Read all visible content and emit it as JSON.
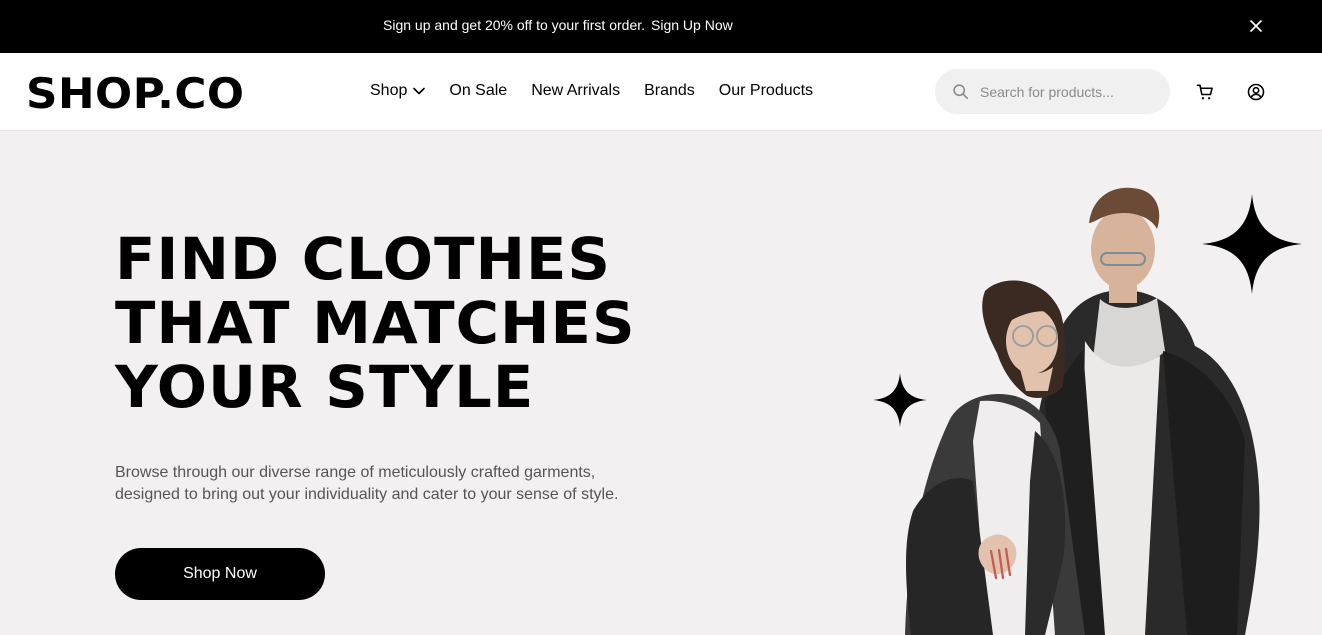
{
  "promo": {
    "text": "Sign up and get 20% off to your first order.",
    "link_label": "Sign Up Now",
    "close_icon": "close-icon"
  },
  "header": {
    "logo": "SHOP.CO",
    "nav": {
      "shop": "Shop",
      "on_sale": "On Sale",
      "new_arrivals": "New Arrivals",
      "brands": "Brands",
      "our_products": "Our Products"
    },
    "search": {
      "placeholder": "Search for products...",
      "value": ""
    },
    "icons": {
      "search": "search-icon",
      "cart": "cart-icon",
      "account": "account-icon",
      "dropdown": "chevron-down-icon"
    }
  },
  "hero": {
    "title": "FIND CLOTHES\nTHAT MATCHES\nYOUR STYLE",
    "description": "Browse through our diverse range of meticulously crafted garments, designed to bring out your individuality and cater to your sense of style.",
    "cta_label": "Shop Now",
    "image_alt": "couple-in-denim-jackets-photo"
  },
  "colors": {
    "black": "#000000",
    "white": "#ffffff",
    "hero_bg": "#f2f0f1",
    "search_bg": "#f0f0f0",
    "muted_text": "#555555"
  }
}
